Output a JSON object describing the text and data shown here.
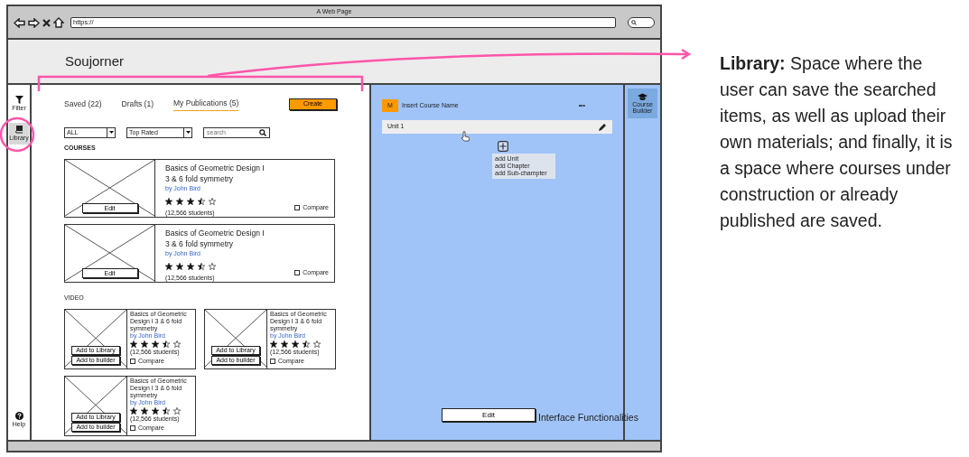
{
  "browser": {
    "title": "A Web Page",
    "url": "https://"
  },
  "app": {
    "brand": "Soujorner"
  },
  "rail": {
    "items": [
      {
        "label": "Filter",
        "kind": "filter",
        "selected": false
      },
      {
        "label": "Library",
        "kind": "library",
        "selected": true
      }
    ],
    "help": "Help"
  },
  "tabs": [
    {
      "label": "Saved (22)",
      "selected": false
    },
    {
      "label": "Drafts (1)",
      "selected": false
    },
    {
      "label": "My Publications (5)",
      "selected": true
    }
  ],
  "create_button": "Create",
  "filters": {
    "type_select": "ALL",
    "sort_select": "Top Rated",
    "search_placeholder": "search"
  },
  "courses": {
    "heading": "COURSES",
    "items": [
      {
        "title": "Basics of Geometric Design I",
        "subtitle": "3 & 6 fold symmetry",
        "author": "by John Bird",
        "stars": 3.5,
        "students": "(12,566 students)",
        "compare": "Compare",
        "checked": false,
        "action": "Edit"
      },
      {
        "title": "Basics of Geometric Design I",
        "subtitle": "3 & 6 fold symmetry",
        "author": "by John Bird",
        "stars": 3.5,
        "students": "(12,566 students)",
        "compare": "Compare",
        "checked": false,
        "action": "Edit"
      }
    ]
  },
  "video": {
    "heading": "VIDEO",
    "items": [
      {
        "title": "Basics of Geometric Design I 3 & 6 fold symmetry",
        "author": "by John Bird",
        "stars": 3.5,
        "students": "(12,566 students)",
        "compare": "Compare",
        "checked": false,
        "actions": [
          "Add to Library",
          "Add to builder"
        ]
      },
      {
        "title": "Basics of Geometric Design I 3 & 6 fold symmetry",
        "author": "by John Bird",
        "stars": 3.5,
        "students": "(12,566 students)",
        "compare": "Compare",
        "checked": false,
        "actions": [
          "Add to Library",
          "Add to builder"
        ]
      },
      {
        "title": "Basics of Geometric Design I 3 & 6 fold symmetry",
        "author": "by John Bird",
        "stars": 3.5,
        "students": "(12,566 students)",
        "compare": "Compare",
        "checked": false,
        "actions": [
          "Add to Library",
          "Add to builder"
        ]
      }
    ]
  },
  "builder": {
    "badge": "M",
    "course_name": "Insert Course Name",
    "menu": "•••",
    "units": [
      {
        "label": "Unit 1"
      }
    ],
    "add_menu": [
      "add Unit",
      "add Chapter",
      "add Sub-champter"
    ],
    "edit_button": "Edit"
  },
  "right_rail": {
    "items": [
      {
        "label": "Course Builder",
        "selected": true
      }
    ]
  },
  "annotation": {
    "text": "**Library:** Space where the user can save the searched items, as well as upload their own materials; and finally, it is a space where courses under construction or already published are saved.",
    "footer": "Interface Functionalities"
  }
}
